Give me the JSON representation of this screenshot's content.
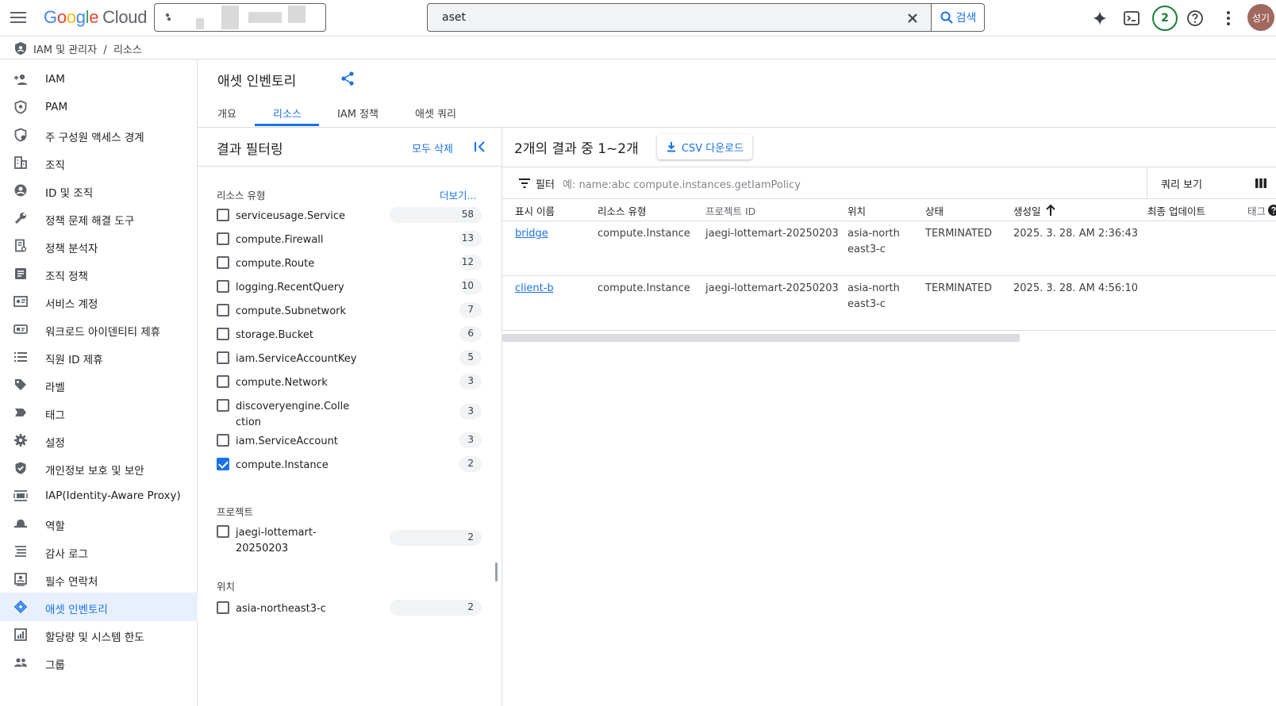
{
  "topbar": {
    "logo_google": [
      "G",
      "o",
      "o",
      "g",
      "l",
      "e"
    ],
    "logo_cloud": "Cloud",
    "search_value": "aset",
    "search_button": "검색",
    "notifications_count": "2",
    "avatar_text": "성기"
  },
  "breadcrumb": "IAM 및 관리자  /  리소스",
  "nav": [
    {
      "label": "IAM",
      "icon": "person-add-icon"
    },
    {
      "label": "PAM",
      "icon": "shield-icon"
    },
    {
      "label": "주 구성원 액세스 경계",
      "icon": "boundary-icon"
    },
    {
      "label": "조직",
      "icon": "building-icon"
    },
    {
      "label": "ID 및 조직",
      "icon": "account-circle-icon"
    },
    {
      "label": "정책 문제 해결 도구",
      "icon": "wrench-icon"
    },
    {
      "label": "정책 분석자",
      "icon": "policy-doc-icon"
    },
    {
      "label": "조직 정책",
      "icon": "list-doc-icon"
    },
    {
      "label": "서비스 계정",
      "icon": "service-account-icon"
    },
    {
      "label": "워크로드 아이덴티티 제휴",
      "icon": "id-card-icon"
    },
    {
      "label": "직원 ID 제휴",
      "icon": "list-icon"
    },
    {
      "label": "라벨",
      "icon": "label-icon"
    },
    {
      "label": "태그",
      "icon": "tag-icon"
    },
    {
      "label": "설정",
      "icon": "gear-icon"
    },
    {
      "label": "개인정보 보호 및 보안",
      "icon": "privacy-shield-icon"
    },
    {
      "label": "IAP(Identity-Aware Proxy)",
      "icon": "iap-icon"
    },
    {
      "label": "역할",
      "icon": "hat-icon"
    },
    {
      "label": "감사 로그",
      "icon": "lines-icon"
    },
    {
      "label": "필수 연락처",
      "icon": "contact-icon"
    },
    {
      "label": "애셋 인벤토리",
      "icon": "diamond-icon",
      "active": true
    },
    {
      "label": "할당량 및 시스템 한도",
      "icon": "quota-icon"
    },
    {
      "label": "그룹",
      "icon": "group-icon"
    }
  ],
  "page": {
    "title": "애셋 인벤토리",
    "tabs": [
      "개요",
      "리소스",
      "IAM 정책",
      "애셋 쿼리"
    ],
    "active_tab": "리소스"
  },
  "filter_panel": {
    "title": "결과 필터링",
    "clear_all": "모두 삭제",
    "resource_type": {
      "title": "리소스 유형",
      "more": "더보기...",
      "items": [
        {
          "label": "serviceusage.Service",
          "count": "58",
          "value": 58,
          "checked": false
        },
        {
          "label": "compute.Firewall",
          "count": "13",
          "value": 13,
          "checked": false
        },
        {
          "label": "compute.Route",
          "count": "12",
          "value": 12,
          "checked": false
        },
        {
          "label": "logging.RecentQuery",
          "count": "10",
          "value": 10,
          "checked": false
        },
        {
          "label": "compute.Subnetwork",
          "count": "7",
          "value": 7,
          "checked": false
        },
        {
          "label": "storage.Bucket",
          "count": "6",
          "value": 6,
          "checked": false
        },
        {
          "label": "iam.ServiceAccountKey",
          "count": "5",
          "value": 5,
          "checked": false
        },
        {
          "label": "compute.Network",
          "count": "3",
          "value": 3,
          "checked": false
        },
        {
          "label": "discoveryengine.Collection",
          "count": "3",
          "value": 3,
          "checked": false
        },
        {
          "label": "iam.ServiceAccount",
          "count": "3",
          "value": 3,
          "checked": false
        },
        {
          "label": "compute.Instance",
          "count": "2",
          "value": 2,
          "checked": true
        }
      ]
    },
    "project": {
      "title": "프로젝트",
      "items": [
        {
          "label": "jaegi-lottemart-20250203",
          "count": "2",
          "checked": false
        }
      ]
    },
    "location": {
      "title": "위치",
      "items": [
        {
          "label": "asia-northeast3-c",
          "count": "2",
          "checked": false
        }
      ]
    }
  },
  "results": {
    "title": "2개의 결과 중 1~2개",
    "csv_button": "CSV 다운로드",
    "filter_label": "필터",
    "filter_placeholder": "예: name:abc compute.instances.getIamPolicy",
    "query_button": "쿼리 보기",
    "columns": [
      "표시 이름",
      "리소스 유형",
      "프로젝트 ID",
      "위치",
      "상태",
      "생성일",
      "최종 업데이트",
      "태그"
    ],
    "rows": [
      {
        "name": "bridge",
        "type": "compute.Instance",
        "project": "jaegi-lottemart-20250203",
        "location": "asia-northeast3-c",
        "state": "TERMINATED",
        "created": "2025. 3. 28. AM 2:36:43",
        "updated": ""
      },
      {
        "name": "client-b",
        "type": "compute.Instance",
        "project": "jaegi-lottemart-20250203",
        "location": "asia-northeast3-c",
        "state": "TERMINATED",
        "created": "2025. 3. 28. AM 4:56:10",
        "updated": ""
      }
    ]
  },
  "colors": {
    "accent": "#1a73e8",
    "active_nav_bg": "#e8f0fe",
    "badge_green": "#188038"
  }
}
